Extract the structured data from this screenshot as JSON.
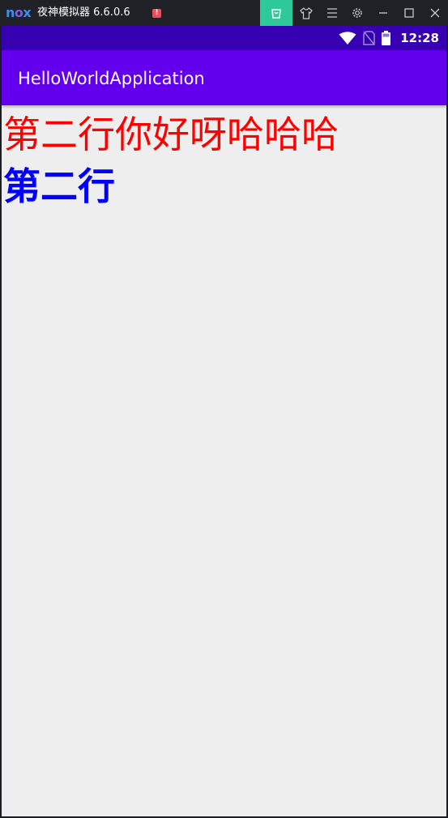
{
  "emulator": {
    "logo_text": [
      "n",
      "o",
      "x"
    ],
    "title": "夜神模拟器 6.6.0.6",
    "alert_mark": "!",
    "buttons": [
      "store-icon",
      "shirt-icon",
      "menu-icon",
      "gear-icon",
      "minimize-icon",
      "maximize-icon",
      "close-icon"
    ],
    "colors": {
      "bar": "#1f2126",
      "store_accent": "#2ec99a",
      "alert": "#e8505b"
    }
  },
  "status_bar": {
    "time": "12:28",
    "icons": [
      "wifi-icon",
      "no-sim-icon",
      "battery-icon"
    ],
    "color": "#3700b3"
  },
  "app_bar": {
    "title": "HelloWorldApplication",
    "color": "#6200ee"
  },
  "content": {
    "line1": {
      "text": "第二行你好呀哈哈哈",
      "color": "#ff0000"
    },
    "line2": {
      "text": "第二行",
      "color": "#0000ff"
    },
    "background": "#eeeeee"
  }
}
